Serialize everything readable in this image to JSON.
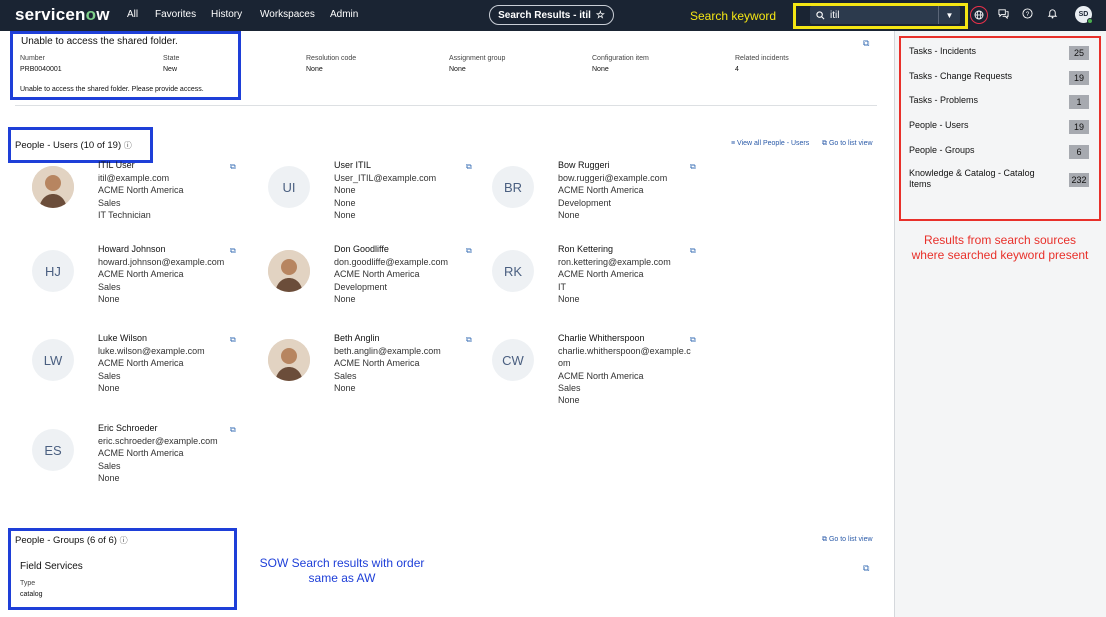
{
  "topbar": {
    "logo_pre": "servicen",
    "logo_o": "o",
    "logo_post": "w",
    "nav": [
      "All",
      "Favorites",
      "History",
      "Workspaces",
      "Admin"
    ],
    "pill_label": "Search Results - itil",
    "search_value": "itil",
    "avatar_initials": "SD",
    "star_icon": "☆",
    "dropdown_icon": "▼"
  },
  "annotations": {
    "search_keyword": "Search keyword",
    "sow_line1": "SOW Search results with order",
    "sow_line2": "same as AW",
    "results_line1": "Results from search sources",
    "results_line2": "where searched keyword present"
  },
  "problem": {
    "title": "Unable to access the shared folder.",
    "fields": [
      {
        "label": "Number",
        "value": "PRB0040001"
      },
      {
        "label": "State",
        "value": "New"
      },
      {
        "label": "Resolution code",
        "value": "None"
      },
      {
        "label": "Assignment group",
        "value": "None"
      },
      {
        "label": "Configuration item",
        "value": "None"
      },
      {
        "label": "Related incidents",
        "value": "4"
      }
    ],
    "description": "Unable to access the shared folder. Please provide access."
  },
  "people_users": {
    "header": "People - Users (10 of 19)",
    "view_all": "View all People - Users",
    "list_view": "Go to list view",
    "users": [
      {
        "initials": "",
        "photo": true,
        "name": "ITIL User",
        "lines": [
          "itil@example.com",
          "ACME North America",
          "Sales",
          "IT Technician"
        ]
      },
      {
        "initials": "UI",
        "photo": false,
        "name": "User ITIL",
        "lines": [
          "User_ITIL@example.com",
          "None",
          "None",
          "None"
        ]
      },
      {
        "initials": "BR",
        "photo": false,
        "name": "Bow Ruggeri",
        "lines": [
          "bow.ruggeri@example.com",
          "ACME North America",
          "Development",
          "None"
        ]
      },
      {
        "initials": "HJ",
        "photo": false,
        "name": "Howard Johnson",
        "lines": [
          "howard.johnson@example.com",
          "ACME North America",
          "Sales",
          "None"
        ]
      },
      {
        "initials": "",
        "photo": true,
        "name": "Don Goodliffe",
        "lines": [
          "don.goodliffe@example.com",
          "ACME North America",
          "Development",
          "None"
        ]
      },
      {
        "initials": "RK",
        "photo": false,
        "name": "Ron Kettering",
        "lines": [
          "ron.kettering@example.com",
          "ACME North America",
          "IT",
          "None"
        ]
      },
      {
        "initials": "LW",
        "photo": false,
        "name": "Luke Wilson",
        "lines": [
          "luke.wilson@example.com",
          "ACME North America",
          "Sales",
          "None"
        ]
      },
      {
        "initials": "",
        "photo": true,
        "name": "Beth Anglin",
        "lines": [
          "beth.anglin@example.com",
          "ACME North America",
          "Sales",
          "None"
        ]
      },
      {
        "initials": "CW",
        "photo": false,
        "name": "Charlie Whitherspoon",
        "lines": [
          "charlie.whitherspoon@example.c",
          "om",
          "ACME North America",
          "Sales",
          "None"
        ]
      },
      {
        "initials": "ES",
        "photo": false,
        "name": "Eric Schroeder",
        "lines": [
          "eric.schroeder@example.com",
          "ACME North America",
          "Sales",
          "None"
        ]
      }
    ]
  },
  "people_groups": {
    "header": "People - Groups (6 of 6)",
    "list_view": "Go to list view",
    "group_name": "Field Services",
    "type_label": "Type",
    "type_value": "catalog"
  },
  "sources": [
    {
      "label": "Tasks - Incidents",
      "count": "25"
    },
    {
      "label": "Tasks - Change Requests",
      "count": "19"
    },
    {
      "label": "Tasks - Problems",
      "count": "1"
    },
    {
      "label": "People - Users",
      "count": "19"
    },
    {
      "label": "People - Groups",
      "count": "6"
    },
    {
      "label": "Knowledge & Catalog - Catalog Items",
      "count": "232"
    }
  ],
  "colors": {
    "topbar": "#1a2433",
    "annotation_blue": "#1e3fd8",
    "annotation_red": "#e8302a",
    "annotation_yellow": "#f5e614"
  }
}
